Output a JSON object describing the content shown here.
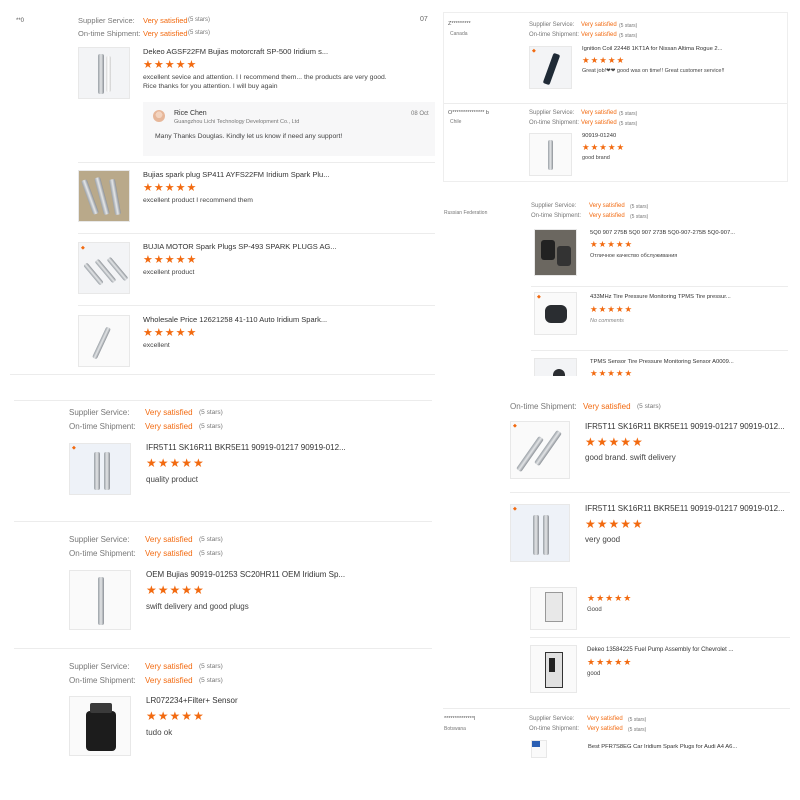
{
  "labels": {
    "supplier_service": "Supplier Service:",
    "ontime_shipment": "On-time Shipment:",
    "rating_value": "Very satisfied",
    "rating_stars": "(5 stars)",
    "stars": "★★★★★"
  },
  "panel_a": {
    "corner_text": "**0",
    "right_clip": "07",
    "reviews": [
      {
        "product": "Dekeo AGSF22FM Bujias motorcraft SP-500 Iridium s...",
        "text1": "excellent sevice and attention. I I recommend them... the products are very good.",
        "text2": "Rice thanks for you attention. I will buy again"
      },
      {
        "product": "Bujias spark plug SP411 AYFS22FM Iridium Spark Plu...",
        "text1": "excellent product I recommend them"
      },
      {
        "product": "BUJIA MOTOR Spark Plugs SP-493 SPARK PLUGS AG...",
        "text1": "excellent product"
      },
      {
        "product": "Wholesale Price 12621258 41-110 Auto Iridium Spark...",
        "text1": "excellent"
      }
    ],
    "reply": {
      "name": "Rice Chen",
      "company": "Guangzhou Lichi Technology Development Co., Ltd",
      "date": "08 Oct",
      "message": "Many Thanks Douglas. Kindly let us know if need any support!"
    }
  },
  "panel_b": {
    "reviews": [
      {
        "buyer": "Z*********",
        "country": "Canada",
        "product": "Ignition Coil 22448 1KT1A for Nissan Altima Rogue 2...",
        "text": "Great job!❤❤    good was on time!!   Great customer service!!"
      },
      {
        "buyer": "O*************** b",
        "country": "Chile",
        "product": "90919-01240",
        "text": "good brand"
      }
    ]
  },
  "panel_c": {
    "country": "Russian Federation",
    "reviews": [
      {
        "product": "5Q0 907 275B 5Q0 907 273B 5Q0-907-275B 5Q0-907...",
        "text": "Отличное качество обслуживания"
      },
      {
        "product": "433MHz Tire Pressure Monitoring TPMS Tire pressur...",
        "text": "No comments"
      },
      {
        "product": "TPMS Sensor Tire Pressure Monitoring Sensor A0009..."
      }
    ]
  },
  "panel_d": {
    "reviews": [
      {
        "product": "IFR5T11 SK16R11 BKR5E11 90919-01217 90919-012...",
        "text": "quality product"
      },
      {
        "product": "OEM Bujias 90919-01253 SC20HR11 OEM Iridium Sp...",
        "text": "swift delivery and good plugs"
      },
      {
        "product": "LR072234+Filter+ Sensor",
        "text": "tudo ok"
      }
    ]
  },
  "panel_e": {
    "reviews": [
      {
        "product": "IFR5T11 SK16R11 BKR5E11 90919-01217 90919-012...",
        "text": "good brand. swift delivery"
      },
      {
        "product": "IFR5T11 SK16R11 BKR5E11 90919-01217 90919-012...",
        "text": "very good"
      }
    ]
  },
  "panel_f": {
    "reviews": [
      {
        "text": "Good"
      },
      {
        "product": "Dekeo 13584225 Fuel Pump Assembly for Chevrolet ...",
        "text": "good"
      }
    ]
  },
  "panel_g": {
    "buyer": "**************l",
    "country": "Botswana",
    "product": "Best PFR7S8EG Car Iridium Spark Plugs for Audi A4 A6..."
  }
}
